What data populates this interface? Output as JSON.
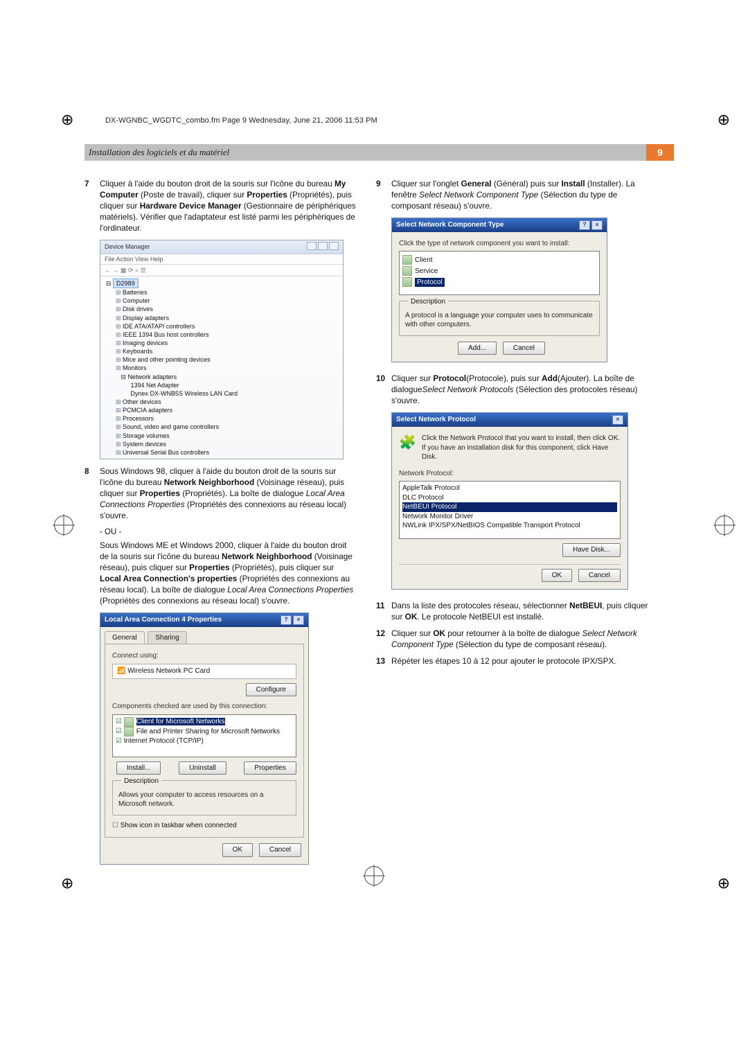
{
  "running_head": "DX-WGNBC_WGDTC_combo.fm  Page 9  Wednesday, June 21, 2006  11:53 PM",
  "section_title": "Installation des logiciels et du matériel",
  "page_number": "9",
  "left": {
    "step7": {
      "num": "7",
      "text_a": "Cliquer à l'aide du bouton droit de la souris sur l'icône du bureau ",
      "b1": "My Computer",
      "text_b": " (Poste de travail), cliquer sur ",
      "b2": "Properties",
      "text_c": " (Propriétés), puis cliquer sur ",
      "b3": "Hardware Device Manager",
      "text_d": " (Gestionnaire de périphériques matériels). Vérifier que l'adaptateur est listé parmi les périphériques de l'ordinateur."
    },
    "devmgr": {
      "title": "Device Manager",
      "menu": "File    Action    View    Help",
      "tools": "←  →   ▦   ⟳   ⌕   ☰",
      "root": "D2989",
      "items": [
        "Batteries",
        "Computer",
        "Disk drives",
        "Display adapters",
        "IDE ATA/ATAPI controllers",
        "IEEE 1394 Bus host controllers",
        "Imaging devices",
        "Keyboards",
        "Mice and other pointing devices",
        "Monitors"
      ],
      "net_label": "Network adapters",
      "net_sub1": "1394 Net Adapter",
      "net_sub2": "Dynex DX-WNB5S Wireless LAN Card",
      "items2": [
        "Other devices",
        "PCMCIA adapters",
        "Processors",
        "Sound, video and game controllers",
        "Storage volumes",
        "System devices",
        "Universal Serial Bus controllers"
      ]
    },
    "step8": {
      "num": "8",
      "text_a": "Sous Windows 98, cliquer à l'aide du bouton droit de la souris sur l'icône du bureau ",
      "b1": "Network Neighborhood",
      "text_b": " (Voisinage réseau), puis cliquer sur ",
      "b2": "Properties",
      "text_c": " (Propriétés). La boîte de dialogue ",
      "i1": "Local Area Connections Properties",
      "text_d": " (Propriétés des connexions au réseau local) s'ouvre."
    },
    "or_text": "- OU -",
    "step8b": {
      "text_a": "Sous Windows ME et Windows 2000, cliquer à l'aide du bouton droit de la souris sur l'icône du bureau ",
      "b1": "Network Neighborhood",
      "text_b": " (Voisinage réseau), puis cliquer sur ",
      "b2": "Properties",
      "text_c": " (Propriétés), puis cliquer sur ",
      "b3": "Local Area Connection's properties",
      "text_d": " (Propriétés des connexions au réseau local). La boîte de dialogue ",
      "i1": "Local Area Connections Properties",
      "text_e": " (Propriétés des connexions au réseau local) s'ouvre."
    },
    "lacp": {
      "title": "Local Area Connection 4 Properties",
      "tab1": "General",
      "tab2": "Sharing",
      "connect_using": "Connect using:",
      "adapter": "Wireless Network PC Card",
      "configure": "Configure",
      "components_label": "Components checked are used by this connection:",
      "comp1": "Client for Microsoft Networks",
      "comp2": "File and Printer Sharing for Microsoft Networks",
      "comp3": "Internet Protocol (TCP/IP)",
      "install": "Install...",
      "uninstall": "Uninstall",
      "properties": "Properties",
      "desc_label": "Description",
      "desc_text": "Allows your computer to access resources on a Microsoft network.",
      "show_icon": "Show icon in taskbar when connected",
      "ok": "OK",
      "cancel": "Cancel"
    }
  },
  "right": {
    "step9": {
      "num": "9",
      "text_a": "Cliquer sur l'onglet ",
      "b1": "General",
      "text_b": " (Général) puis sur ",
      "b2": "Install",
      "text_c": " (Installer). La fenêtre ",
      "i1": "Select Network Component Type",
      "text_d": " (Sélection du type de composant réseau) s'ouvre."
    },
    "snct": {
      "title": "Select Network Component Type",
      "prompt": "Click the type of network component you want to install:",
      "opt1": "Client",
      "opt2": "Service",
      "opt3": "Protocol",
      "desc_label": "Description",
      "desc_text": "A protocol is a language your computer uses to communicate with other computers.",
      "add": "Add...",
      "cancel": "Cancel"
    },
    "step10": {
      "num": "10",
      "text_a": "Cliquer sur ",
      "b1": "Protocol",
      "text_b": "(Protocole), puis sur ",
      "b2": "Add",
      "text_c": "(Ajouter). La boîte de dialogue",
      "i1": "Select Network Protocols",
      "text_d": " (Sélection des protocoles réseau) s'ouvre."
    },
    "snp": {
      "title": "Select Network Protocol",
      "instr": "Click the Network Protocol that you want to install, then click OK. If you have an installation disk for this component, click Have Disk.",
      "list_label": "Network Protocol:",
      "p1": "AppleTalk Protocol",
      "p2": "DLC Protocol",
      "p3": "NetBEUI Protocol",
      "p4": "Network Monitor Driver",
      "p5": "NWLink IPX/SPX/NetBIOS Compatible Transport Protocol",
      "have_disk": "Have Disk...",
      "ok": "OK",
      "cancel": "Cancel"
    },
    "step11": {
      "num": "11",
      "text_a": "Dans la liste des protocoles réseau, sélectionner ",
      "b1": "NetBEUI",
      "text_b": ", puis cliquer sur ",
      "b2": "OK",
      "text_c": ". Le protocole NetBEUI est installé."
    },
    "step12": {
      "num": "12",
      "text_a": "Cliquer sur ",
      "b1": "OK",
      "text_b": " pour retourner à la boîte de dialogue ",
      "i1": "Select Network Component Type",
      "text_c": " (Sélection du type de composant réseau)."
    },
    "step13": {
      "num": "13",
      "text": "Répéter les étapes 10 à 12 pour ajouter le protocole IPX/SPX."
    }
  }
}
